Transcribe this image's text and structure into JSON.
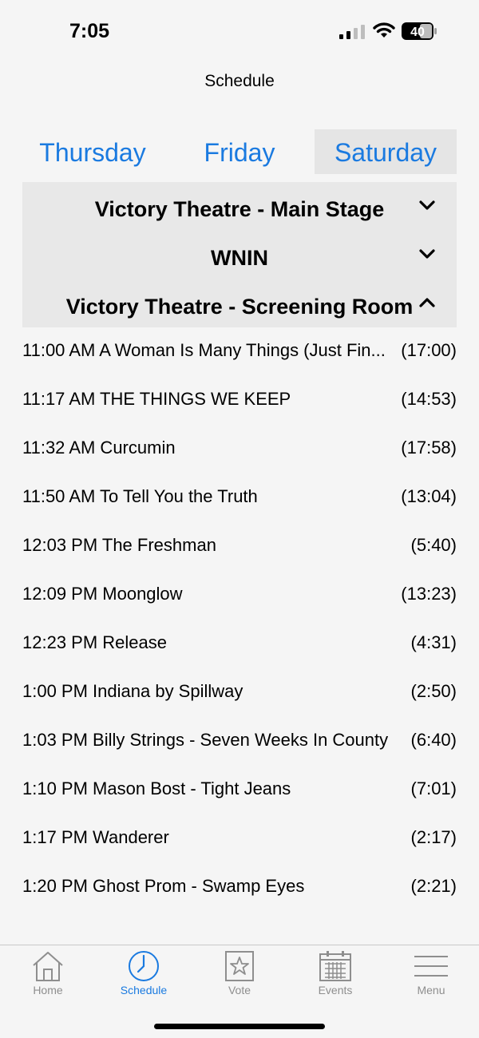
{
  "status": {
    "time": "7:05",
    "battery": "40"
  },
  "nav": {
    "title": "Schedule"
  },
  "days": [
    {
      "label": "Thursday",
      "selected": false
    },
    {
      "label": "Friday",
      "selected": false
    },
    {
      "label": "Saturday",
      "selected": true
    }
  ],
  "venues": [
    {
      "name": "Victory Theatre - Main Stage",
      "state": "collapsed"
    },
    {
      "name": "WNIN",
      "state": "collapsed"
    },
    {
      "name": "Victory Theatre - Screening Room",
      "state": "expanded"
    }
  ],
  "schedule": [
    {
      "title": "11:00 AM A Woman Is Many Things (Just Fin...",
      "duration": "(17:00)"
    },
    {
      "title": "11:17 AM THE THINGS WE KEEP",
      "duration": "(14:53)"
    },
    {
      "title": "11:32 AM Curcumin",
      "duration": "(17:58)"
    },
    {
      "title": "11:50 AM To Tell You the Truth",
      "duration": "(13:04)"
    },
    {
      "title": "12:03 PM The Freshman",
      "duration": "(5:40)"
    },
    {
      "title": "12:09 PM Moonglow",
      "duration": "(13:23)"
    },
    {
      "title": "12:23 PM Release",
      "duration": "(4:31)"
    },
    {
      "title": "1:00 PM Indiana by Spillway",
      "duration": "(2:50)"
    },
    {
      "title": "1:03 PM Billy Strings - Seven Weeks In County",
      "duration": "(6:40)"
    },
    {
      "title": "1:10 PM Mason Bost - Tight Jeans",
      "duration": "(7:01)"
    },
    {
      "title": "1:17 PM Wanderer",
      "duration": "(2:17)"
    },
    {
      "title": "1:20 PM Ghost Prom - Swamp Eyes",
      "duration": "(2:21)"
    }
  ],
  "tabbar": [
    {
      "label": "Home",
      "icon": "home-icon"
    },
    {
      "label": "Schedule",
      "icon": "clock-icon",
      "active": true
    },
    {
      "label": "Vote",
      "icon": "star-icon"
    },
    {
      "label": "Events",
      "icon": "calendar-icon"
    },
    {
      "label": "Menu",
      "icon": "menu-icon"
    }
  ],
  "colors": {
    "accent": "#1a7ae0",
    "inactive": "#8e8e8e",
    "background": "#f5f5f5",
    "header_bg": "#e8e8e8"
  }
}
